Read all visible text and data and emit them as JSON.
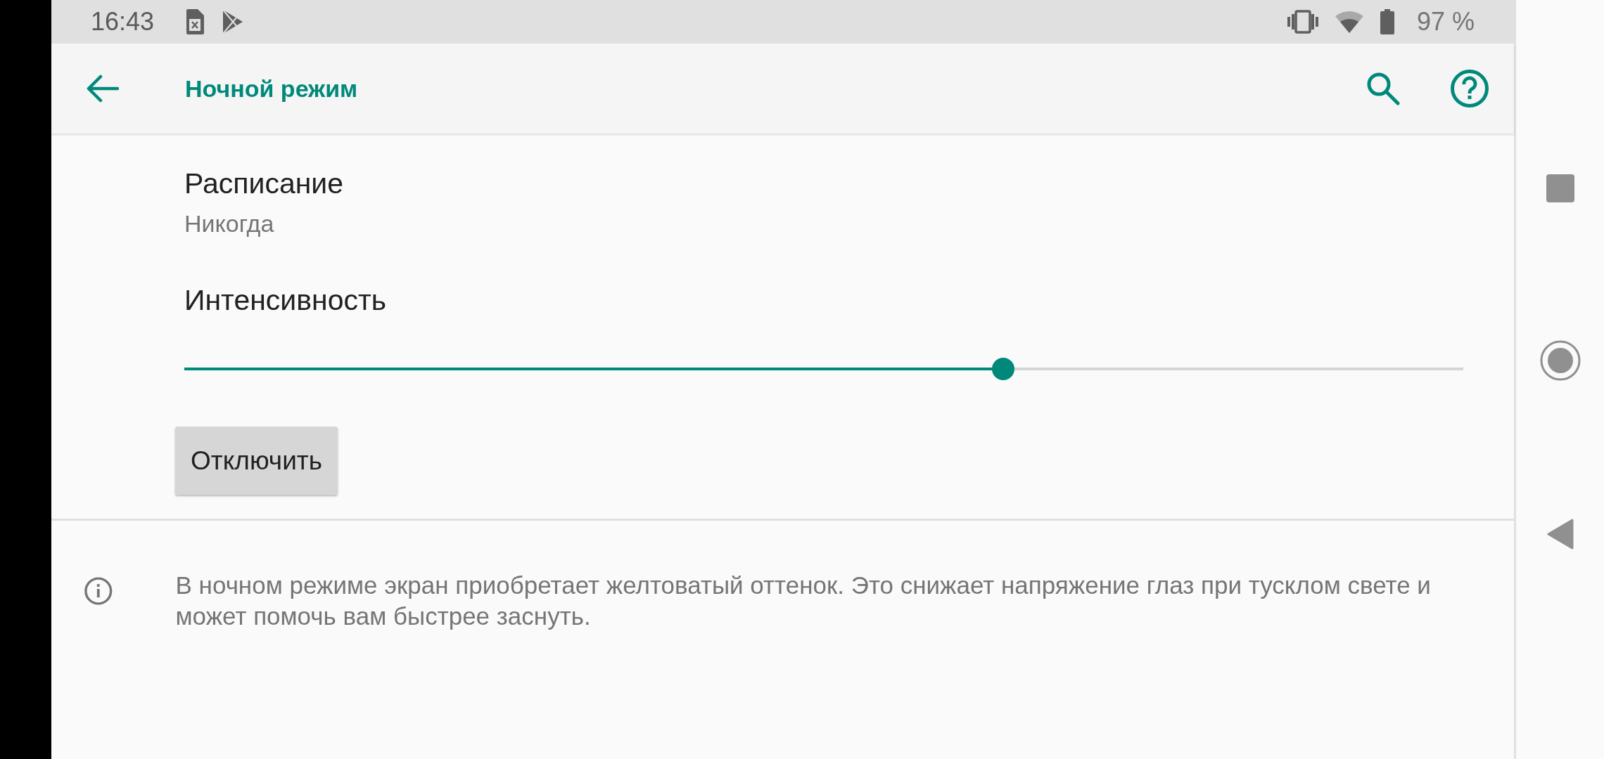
{
  "status_bar": {
    "time": "16:43",
    "battery": "97 %"
  },
  "toolbar": {
    "title": "Ночной режим"
  },
  "schedule": {
    "label": "Расписание",
    "value": "Никогда"
  },
  "intensity": {
    "label": "Интенсивность",
    "level": 0.64
  },
  "button": {
    "label": "Отключить"
  },
  "info": {
    "text": "В ночном режиме экран приобретает желтоватый оттенок. Это снижает напряжение глаз при тусклом свете и может помочь вам быстрее заснуть."
  }
}
